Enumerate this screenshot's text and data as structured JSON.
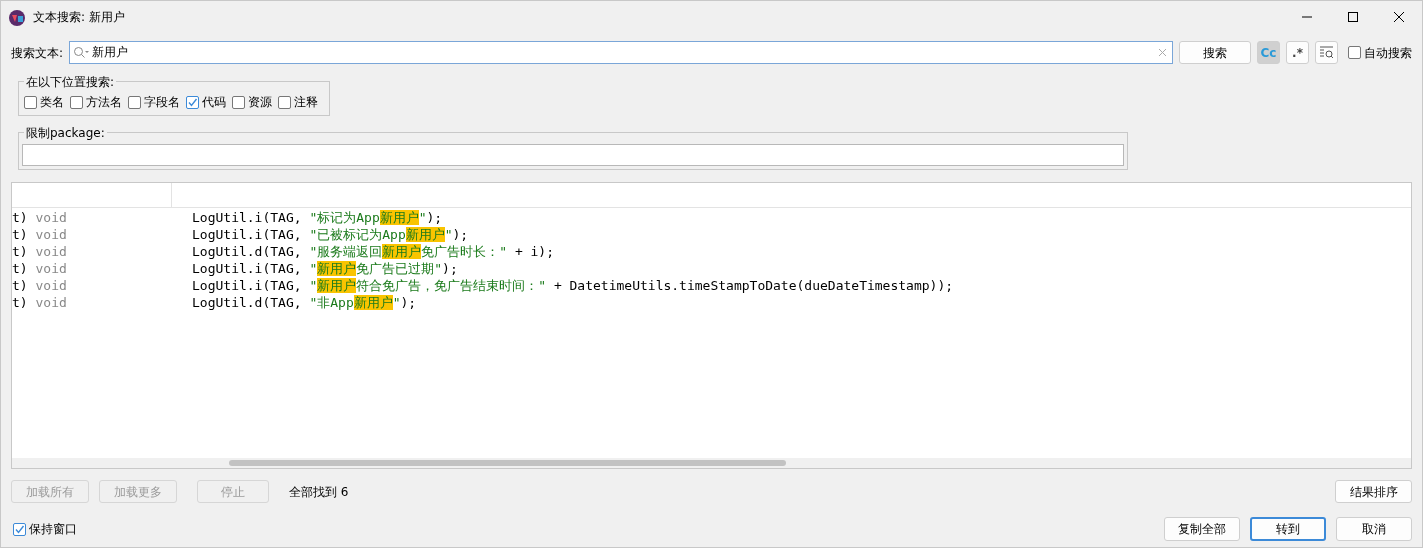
{
  "window": {
    "title": "文本搜索: 新用户"
  },
  "search": {
    "label": "搜索文本:",
    "value": "新用户",
    "button": "搜索",
    "toggles": [
      {
        "kind": "case",
        "label": "Cc",
        "selected": true
      },
      {
        "kind": "regex",
        "label": ".*",
        "selected": false
      },
      {
        "kind": "words",
        "selected": false
      }
    ],
    "auto": {
      "label": "自动搜索",
      "checked": false
    }
  },
  "scope": {
    "title": "在以下位置搜索:",
    "options": [
      {
        "label": "类名",
        "checked": false
      },
      {
        "label": "方法名",
        "checked": false
      },
      {
        "label": "字段名",
        "checked": false
      },
      {
        "label": "代码",
        "checked": true
      },
      {
        "label": "资源",
        "checked": false
      },
      {
        "label": "注释",
        "checked": false
      }
    ]
  },
  "package": {
    "title": "限制package:"
  },
  "results": {
    "rows": [
      {
        "column_1": [
          {
            "kind": "code",
            "text": "t) "
          },
          {
            "kind": "keyword",
            "text": "void"
          }
        ],
        "code": [
          {
            "kind": "code",
            "text": "LogUtil.i(TAG, "
          },
          {
            "kind": "string",
            "text": "\"标记为App"
          },
          {
            "kind": "match",
            "text": "新用户"
          },
          {
            "kind": "string",
            "text": "\""
          },
          {
            "kind": "code",
            "text": ");"
          }
        ]
      },
      {
        "column_1": [
          {
            "kind": "code",
            "text": "t) "
          },
          {
            "kind": "keyword",
            "text": "void"
          }
        ],
        "code": [
          {
            "kind": "code",
            "text": "LogUtil.i(TAG, "
          },
          {
            "kind": "string",
            "text": "\"已被标记为App"
          },
          {
            "kind": "match",
            "text": "新用户"
          },
          {
            "kind": "string",
            "text": "\""
          },
          {
            "kind": "code",
            "text": ");"
          }
        ]
      },
      {
        "column_1": [
          {
            "kind": "code",
            "text": "t) "
          },
          {
            "kind": "keyword",
            "text": "void"
          }
        ],
        "code": [
          {
            "kind": "code",
            "text": "LogUtil.d(TAG, "
          },
          {
            "kind": "string",
            "text": "\"服务端返回"
          },
          {
            "kind": "match",
            "text": "新用户"
          },
          {
            "kind": "string",
            "text": "免广告时长：\""
          },
          {
            "kind": "code",
            "text": " + i);"
          }
        ]
      },
      {
        "column_1": [
          {
            "kind": "code",
            "text": "t) "
          },
          {
            "kind": "keyword",
            "text": "void"
          }
        ],
        "code": [
          {
            "kind": "code",
            "text": "LogUtil.i(TAG, "
          },
          {
            "kind": "string",
            "text": "\""
          },
          {
            "kind": "match",
            "text": "新用户"
          },
          {
            "kind": "string",
            "text": "免广告已过期\""
          },
          {
            "kind": "code",
            "text": ");"
          }
        ]
      },
      {
        "column_1": [
          {
            "kind": "code",
            "text": "t) "
          },
          {
            "kind": "keyword",
            "text": "void"
          }
        ],
        "code": [
          {
            "kind": "code",
            "text": "LogUtil.i(TAG, "
          },
          {
            "kind": "string",
            "text": "\""
          },
          {
            "kind": "match",
            "text": "新用户"
          },
          {
            "kind": "string",
            "text": "符合免广告，免广告结束时间：\""
          },
          {
            "kind": "code",
            "text": " + DatetimeUtils.timeStampToDate(dueDateTimestamp));"
          }
        ]
      },
      {
        "column_1": [
          {
            "kind": "code",
            "text": "t) "
          },
          {
            "kind": "keyword",
            "text": "void"
          }
        ],
        "code": [
          {
            "kind": "code",
            "text": "LogUtil.d(TAG, "
          },
          {
            "kind": "string",
            "text": "\"非App"
          },
          {
            "kind": "match",
            "text": "新用户"
          },
          {
            "kind": "string",
            "text": "\""
          },
          {
            "kind": "code",
            "text": ");"
          }
        ]
      }
    ]
  },
  "actions": [
    {
      "label": "加载所有",
      "disabled": true
    },
    {
      "label": "加载更多",
      "disabled": true
    },
    {
      "label": "停止",
      "disabled": true
    }
  ],
  "status": "全部找到 6",
  "sort_button": "结果排序",
  "keep_window": {
    "label": "保持窗口",
    "checked": true
  },
  "buttons": [
    {
      "label": "复制全部",
      "default": false
    },
    {
      "label": "转到",
      "default": true
    },
    {
      "label": "取消",
      "default": false
    }
  ]
}
